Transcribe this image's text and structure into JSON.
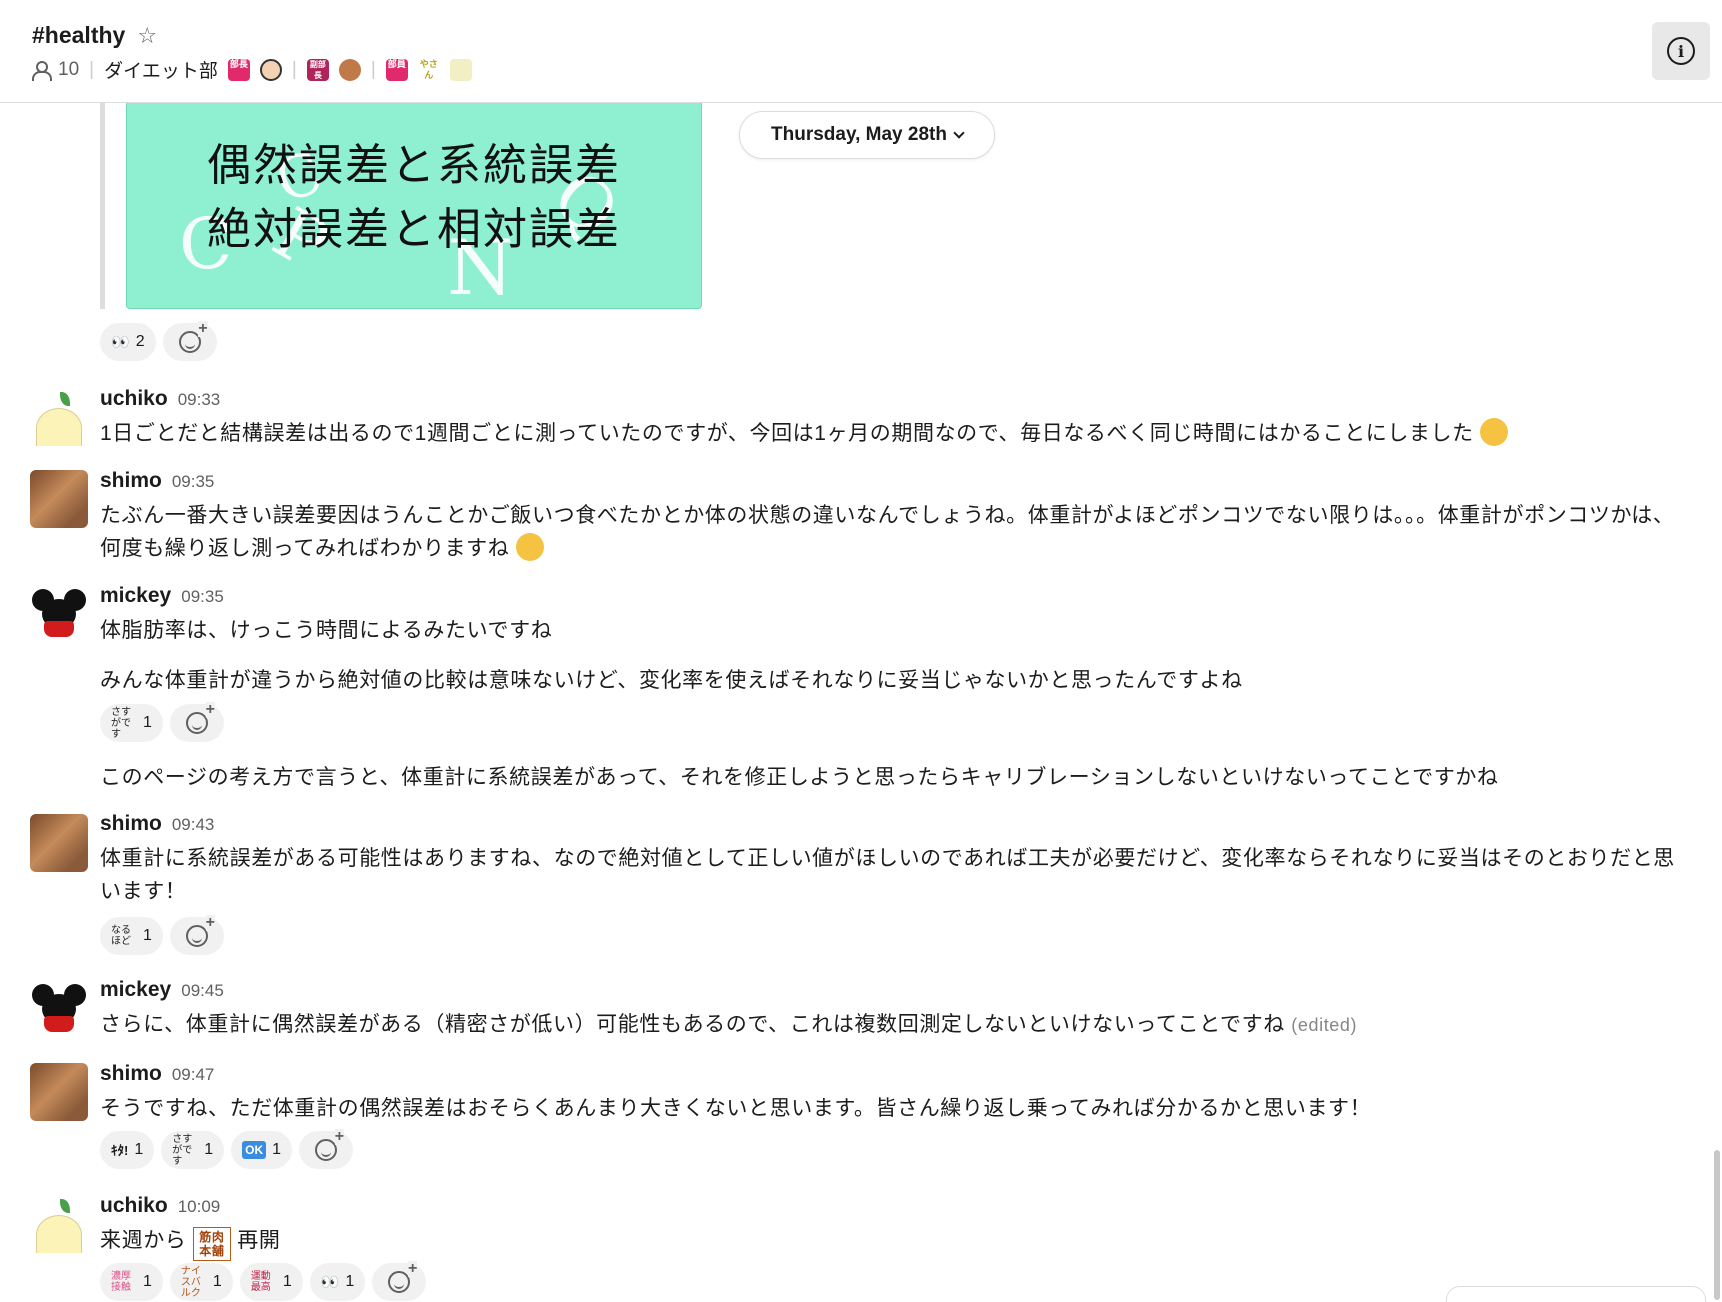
{
  "channel": {
    "name": "#healthy",
    "member_count": "10",
    "topic_text": "ダイエット部",
    "topic_stamp_1": "部長",
    "topic_stamp_2": "副部長",
    "topic_stamp_3": "部員",
    "topic_stamp_3b": "やさん"
  },
  "attachment": {
    "line1": "偶然誤差と系統誤差",
    "line2": "絶対誤差と相対誤差",
    "deco_letters": [
      "C",
      "P",
      "N",
      "Q"
    ]
  },
  "date_divider": {
    "label": "Thursday, May 28th"
  },
  "reactions_top": [
    {
      "emoji": "👀",
      "count": "2"
    }
  ],
  "messages": [
    {
      "user": "uchiko",
      "time": "09:33",
      "text": "1日ごとだと結構誤差は出るので1週間ごとに測っていたのですが、今回は1ヶ月の期間なので、毎日なるべく同じ時間にはかることにしました"
    },
    {
      "user": "shimo",
      "time": "09:35",
      "text": "たぶん一番大きい誤差要因はうんことかご飯いつ食べたかとか体の状態の違いなんでしょうね。体重計がよほどポンコツでない限りは。。。体重計がポンコツかは、何度も繰り返し測ってみればわかりますね"
    },
    {
      "user": "mickey",
      "time": "09:35",
      "text": "体脂肪率は、けっこう時間によるみたいですね",
      "text2": "みんな体重計が違うから絶対値の比較は意味ないけど、変化率を使えばそれなりに妥当じゃないかと思ったんですよね",
      "text3": "このページの考え方で言うと、体重計に系統誤差があって、それを修正しようと思ったらキャリブレーションしないといけないってことですかね"
    },
    {
      "user": "shimo",
      "time": "09:43",
      "text": "体重計に系統誤差がある可能性はありますね、なので絶対値として正しい値がほしいのであれば工夫が必要だけど、変化率ならそれなりに妥当はそのとおりだと思います！"
    },
    {
      "user": "mickey",
      "time": "09:45",
      "text": "さらに、体重計に偶然誤差がある（精密さが低い）可能性もあるので、これは複数回測定しないといけないってことですね",
      "edited": "(edited)"
    },
    {
      "user": "shimo",
      "time": "09:47",
      "text": "そうですね、ただ体重計の偶然誤差はおそらくあんまり大きくないと思います。皆さん繰り返し乗ってみれば分かるかと思います！"
    },
    {
      "user": "uchiko",
      "time": "10:09",
      "text_before": "来週から",
      "stamp": "筋肉本舗",
      "text_after": "再開"
    }
  ],
  "reactions_mickey1": [
    {
      "emoji": "さすがです",
      "count": "1"
    }
  ],
  "reactions_shimo2": [
    {
      "emoji": "なるほど",
      "count": "1"
    }
  ],
  "reactions_shimo3": [
    {
      "emoji": "ｷﾀ!",
      "count": "1"
    },
    {
      "emoji": "さすがです",
      "count": "1"
    },
    {
      "emoji": "OK",
      "count": "1"
    }
  ],
  "reactions_uchiko2": [
    {
      "emoji": "濃厚接触",
      "count": "1"
    },
    {
      "emoji": "ナイスバルク",
      "count": "1"
    },
    {
      "emoji": "運動最高",
      "count": "1"
    },
    {
      "emoji": "👀",
      "count": "1"
    }
  ],
  "colors": {
    "accent_green": "#8ff0d1",
    "text": "#1d1c1d",
    "muted": "#616061",
    "reaction_bg": "#f1f1f1"
  }
}
